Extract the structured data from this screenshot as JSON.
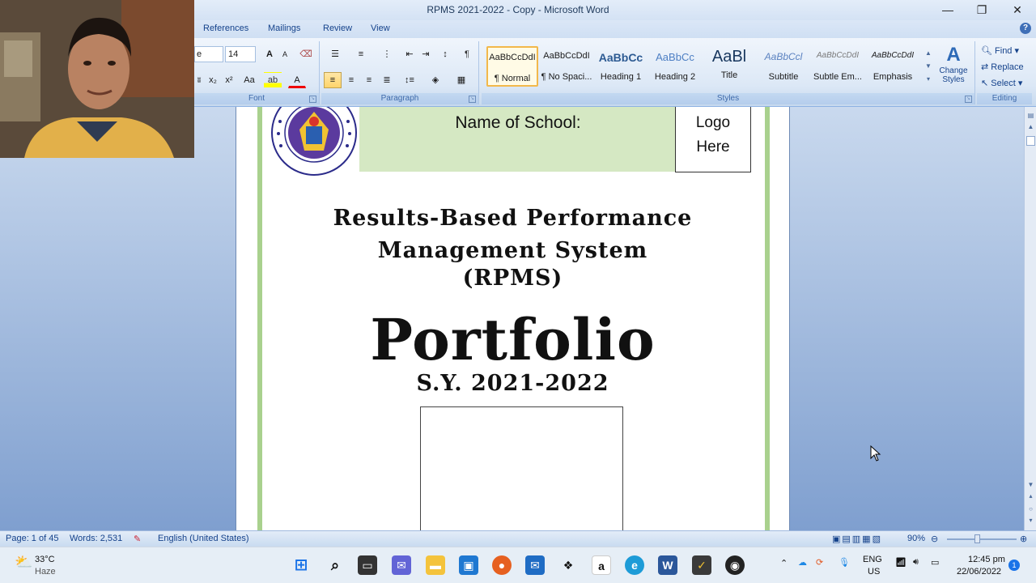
{
  "window": {
    "title": "RPMS 2021-2022 - Copy - Microsoft Word",
    "min": "—",
    "max": "❐",
    "close": "✕"
  },
  "tabs": [
    "References",
    "Mailings",
    "Review",
    "View"
  ],
  "ribbon": {
    "font_name": "e",
    "font_size": "14",
    "font_group": "Font",
    "paragraph_group": "Paragraph",
    "styles_group": "Styles",
    "editing_group": "Editing",
    "styles": [
      {
        "sample": "AaBbCcDdI",
        "name": "¶ Normal"
      },
      {
        "sample": "AaBbCcDdI",
        "name": "¶ No Spaci..."
      },
      {
        "sample": "AaBbCc",
        "name": "Heading 1"
      },
      {
        "sample": "AaBbCc",
        "name": "Heading 2"
      },
      {
        "sample": "AaBl",
        "name": "Title"
      },
      {
        "sample": "AaBbCcl",
        "name": "Subtitle"
      },
      {
        "sample": "AaBbCcDdI",
        "name": "Subtle Em..."
      },
      {
        "sample": "AaBbCcDdI",
        "name": "Emphasis"
      }
    ],
    "change_styles": "Change Styles",
    "find": "Find",
    "replace": "Replace",
    "select": "Select"
  },
  "document": {
    "school_label": "Name of School:",
    "logo_line1": "Logo",
    "logo_line2": "Here",
    "title_line1": "Results-Based Performance",
    "title_line2": "Management System",
    "title_line3": "(RPMS)",
    "portfolio": "Portfolio",
    "school_year": "S.Y. 2021-2022"
  },
  "status": {
    "page": "Page: 1 of 45",
    "words": "Words: 2,531",
    "language": "English (United States)",
    "zoom": "90%"
  },
  "taskbar": {
    "weather_temp": "33°C",
    "weather_desc": "Haze",
    "lang1": "ENG",
    "lang2": "US",
    "time": "12:45 pm",
    "date": "22/06/2022",
    "notif": "1"
  }
}
